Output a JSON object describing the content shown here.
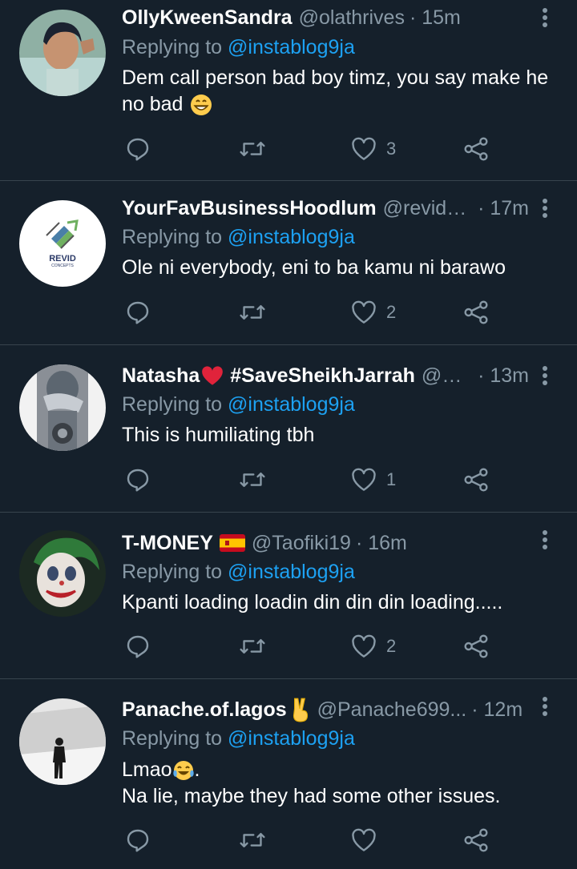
{
  "tweets": [
    {
      "name": "OllyKweenSandra",
      "handle": "@olathrives",
      "time": "· 15m",
      "replying_prefix": "Replying to ",
      "replying_to": "@instablog9ja",
      "text": "Dem call person bad boy timz, you say make he no bad",
      "like_count": "3"
    },
    {
      "name": "YourFavBusinessHoodlum",
      "handle": "@revidc...",
      "time": "· 17m",
      "replying_prefix": "Replying to ",
      "replying_to": "@instablog9ja",
      "text": "Ole ni everybody, eni to ba kamu ni barawo",
      "like_count": "2",
      "avatar_text": "REVID",
      "avatar_subtext": "CONCEPTS"
    },
    {
      "name": "Natasha",
      "name_suffix": "#SaveSheikhJarrah",
      "handle": "@N...",
      "time": "· 13m",
      "replying_prefix": "Replying to ",
      "replying_to": "@instablog9ja",
      "text": "This is humiliating tbh",
      "like_count": "1"
    },
    {
      "name": "T-MONEY",
      "handle": "@Taofiki19",
      "time": "· 16m",
      "replying_prefix": "Replying to ",
      "replying_to": "@instablog9ja",
      "text": "Kpanti loading loadin din din din loading.....",
      "like_count": "2"
    },
    {
      "name": "Panache.of.lagos",
      "handle": "@Panache699...",
      "time": "· 12m",
      "replying_prefix": "Replying to ",
      "replying_to": "@instablog9ja",
      "text_line1": "Lmao",
      "text_line1_end": ".",
      "text_line2": "Na lie, maybe they had some other issues.",
      "like_count": ""
    }
  ],
  "icons": {
    "reply": "reply-icon",
    "retweet": "retweet-icon",
    "like": "heart-icon",
    "share": "share-icon",
    "more": "more-vertical-icon"
  },
  "colors": {
    "background": "#15202b",
    "secondary_text": "#8899a6",
    "link": "#1da1f2",
    "divider": "#38444d"
  }
}
